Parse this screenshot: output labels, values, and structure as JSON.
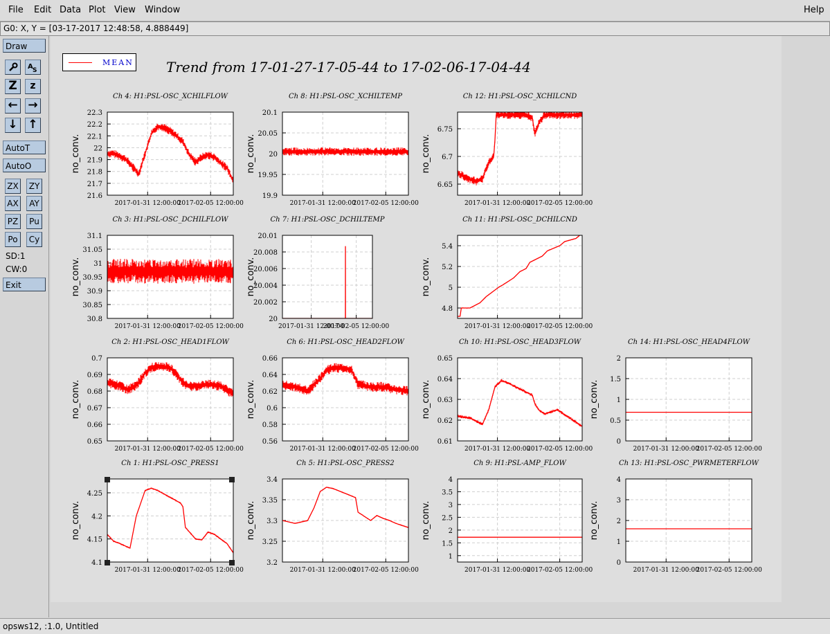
{
  "menu": {
    "file": "File",
    "edit": "Edit",
    "data": "Data",
    "plot": "Plot",
    "view": "View",
    "window": "Window",
    "help": "Help"
  },
  "coord_readout": "G0: X, Y = [03-17-2017 12:48:58, 4.888449]",
  "panel": {
    "draw": "Draw",
    "autot": "AutoT",
    "autoo": "AutoO",
    "zx": "ZX",
    "zy": "ZY",
    "ax": "AX",
    "ay": "AY",
    "pz": "PZ",
    "pu": "Pu",
    "po": "Po",
    "cy": "Cy",
    "sd": "SD:1",
    "cw": "CW:0",
    "exit": "Exit",
    "icons": {
      "draw_tool": "wrench-icon",
      "text_tool": "text-tool-icon",
      "zoom_z_big": "Z",
      "zoom_z_small": "z",
      "left": "←",
      "right": "→",
      "down": "↓",
      "up": "↑"
    }
  },
  "legend_label": "MEAN",
  "title": "Trend from 17-01-27-17-05-44 to 17-02-06-17-04-44",
  "status": "opsws12, :1.0, Untitled",
  "colors": {
    "series": "#ff0000",
    "legend_text": "#0000cc",
    "button": "#b8cbe0"
  },
  "chart_data": [
    {
      "type": "line",
      "title": "Ch 4: H1:PSL-OSC_XCHILFLOW",
      "ylabel": "no_conv.",
      "yticks": [
        "22.3",
        "22.2",
        "22.1",
        "22",
        "21.9",
        "21.8",
        "21.7",
        "21.6"
      ],
      "ylim": [
        21.6,
        22.3
      ],
      "xticks": [
        "2017-01-31 12:00:00",
        "2017-02-05 12:00:00"
      ],
      "x": [
        0,
        0.05,
        0.1,
        0.15,
        0.2,
        0.25,
        0.3,
        0.35,
        0.4,
        0.45,
        0.5,
        0.55,
        0.6,
        0.65,
        0.7,
        0.75,
        0.8,
        0.85,
        0.9,
        0.95,
        1
      ],
      "y": [
        21.95,
        21.95,
        21.93,
        21.9,
        21.84,
        21.78,
        21.95,
        22.12,
        22.18,
        22.17,
        22.14,
        22.1,
        22.05,
        21.94,
        21.88,
        21.92,
        21.94,
        21.92,
        21.87,
        21.83,
        21.72
      ],
      "band": 0.07
    },
    {
      "type": "line",
      "title": "Ch 8: H1:PSL-OSC_XCHILTEMP",
      "ylabel": "no_conv.",
      "yticks": [
        "20.1",
        "20.05",
        "20",
        "19.95",
        "19.9"
      ],
      "ylim": [
        19.9,
        20.1
      ],
      "xticks": [
        "2017-01-31 12:00:00",
        "2017-02-05 12:00:00"
      ],
      "x": [
        0,
        0.1,
        0.2,
        0.3,
        0.4,
        0.5,
        0.6,
        0.7,
        0.8,
        0.9,
        1
      ],
      "y": [
        20.005,
        20.005,
        20.005,
        20.005,
        20.005,
        20.005,
        20.005,
        20.005,
        20.005,
        20.005,
        20.005
      ],
      "band": 0.02
    },
    {
      "type": "line",
      "title": "Ch 12: H1:PSL-OSC_XCHILCND",
      "ylabel": "no_conv.",
      "yticks": [
        "6.75",
        "6.7",
        "6.65"
      ],
      "ylim": [
        6.63,
        6.78
      ],
      "xticks": [
        "2017-01-31 12:00:00",
        "2017-02-05 12:00:00"
      ],
      "x": [
        0,
        0.08,
        0.15,
        0.2,
        0.25,
        0.29,
        0.3,
        0.31,
        0.4,
        0.5,
        0.55,
        0.6,
        0.62,
        0.65,
        0.7,
        0.8,
        0.9,
        1
      ],
      "y": [
        6.67,
        6.66,
        6.655,
        6.66,
        6.69,
        6.7,
        6.73,
        6.775,
        6.775,
        6.775,
        6.775,
        6.77,
        6.74,
        6.76,
        6.775,
        6.775,
        6.775,
        6.775
      ],
      "band": 0.015
    },
    {
      "type": "line",
      "title": "Ch 3: H1:PSL-OSC_DCHILFLOW",
      "ylabel": "no_conv.",
      "yticks": [
        "31.1",
        "31.05",
        "31",
        "30.95",
        "30.9",
        "30.85",
        "30.8"
      ],
      "ylim": [
        30.8,
        31.1
      ],
      "xticks": [
        "2017-01-31 12:00:00",
        "2017-02-05 12:00:00"
      ],
      "x": [
        0,
        0.1,
        0.2,
        0.3,
        0.4,
        0.5,
        0.6,
        0.7,
        0.8,
        0.9,
        1
      ],
      "y": [
        30.97,
        30.97,
        30.97,
        30.97,
        30.97,
        30.97,
        30.97,
        30.97,
        30.97,
        30.97,
        30.97
      ],
      "band": 0.09
    },
    {
      "type": "line",
      "title": "Ch 7: H1:PSL-OSC_DCHILTEMP",
      "ylabel": "no_conv.",
      "yticks": [
        "20.01",
        "20.008",
        "20.006",
        "20.004",
        "20.002",
        "20"
      ],
      "ylim": [
        20,
        20.01
      ],
      "xticks": [
        "2017-01-31 12:00:00",
        "2017-02-05 12:00:00"
      ],
      "x": [
        0,
        0.699,
        0.7,
        0.701,
        1
      ],
      "y": [
        20,
        20,
        20.0087,
        20,
        20
      ],
      "band": 0
    },
    {
      "type": "line",
      "title": "Ch 11: H1:PSL-OSC_DCHILCND",
      "ylabel": "no_conv.",
      "yticks": [
        "5.4",
        "5.2",
        "5",
        "4.8"
      ],
      "ylim": [
        4.7,
        5.5
      ],
      "xticks": [
        "2017-01-31 12:00:00",
        "2017-02-05 12:00:00"
      ],
      "x": [
        0,
        0.02,
        0.03,
        0.1,
        0.18,
        0.23,
        0.33,
        0.36,
        0.45,
        0.5,
        0.55,
        0.58,
        0.68,
        0.72,
        0.82,
        0.86,
        0.95,
        1
      ],
      "y": [
        4.72,
        4.72,
        4.8,
        4.8,
        4.85,
        4.91,
        5.0,
        5.02,
        5.09,
        5.15,
        5.18,
        5.24,
        5.3,
        5.35,
        5.4,
        5.44,
        5.47,
        5.52
      ],
      "band": 0.01
    },
    {
      "type": "line",
      "title": "Ch 2: H1:PSL-OSC_HEAD1FLOW",
      "ylabel": "no_conv.",
      "yticks": [
        "0.7",
        "0.69",
        "0.68",
        "0.67",
        "0.66",
        "0.65"
      ],
      "ylim": [
        0.65,
        0.7
      ],
      "xticks": [
        "2017-01-31 12:00:00",
        "2017-02-05 12:00:00"
      ],
      "x": [
        0,
        0.1,
        0.15,
        0.2,
        0.25,
        0.3,
        0.35,
        0.4,
        0.5,
        0.55,
        0.6,
        0.65,
        0.7,
        0.8,
        0.9,
        1
      ],
      "y": [
        0.685,
        0.683,
        0.681,
        0.682,
        0.685,
        0.691,
        0.694,
        0.695,
        0.694,
        0.69,
        0.685,
        0.683,
        0.683,
        0.684,
        0.683,
        0.678
      ],
      "band": 0.006
    },
    {
      "type": "line",
      "title": "Ch 6: H1:PSL-OSC_HEAD2FLOW",
      "ylabel": "no_conv.",
      "yticks": [
        "0.66",
        "0.64",
        "0.62",
        "0.6",
        "0.58",
        "0.56"
      ],
      "ylim": [
        0.56,
        0.66
      ],
      "xticks": [
        "2017-01-31 12:00:00",
        "2017-02-05 12:00:00"
      ],
      "x": [
        0,
        0.1,
        0.2,
        0.3,
        0.35,
        0.4,
        0.5,
        0.55,
        0.6,
        0.7,
        0.8,
        0.9,
        1
      ],
      "y": [
        0.628,
        0.625,
        0.62,
        0.635,
        0.645,
        0.648,
        0.648,
        0.645,
        0.628,
        0.625,
        0.625,
        0.622,
        0.62
      ],
      "band": 0.012
    },
    {
      "type": "line",
      "title": "Ch 10: H1:PSL-OSC_HEAD3FLOW",
      "ylabel": "no_conv.",
      "yticks": [
        "0.65",
        "0.64",
        "0.63",
        "0.62",
        "0.61"
      ],
      "ylim": [
        0.61,
        0.65
      ],
      "xticks": [
        "2017-01-31 12:00:00",
        "2017-02-05 12:00:00"
      ],
      "x": [
        0,
        0.1,
        0.2,
        0.25,
        0.3,
        0.35,
        0.4,
        0.5,
        0.6,
        0.62,
        0.65,
        0.7,
        0.8,
        0.85,
        0.9,
        1
      ],
      "y": [
        0.622,
        0.621,
        0.618,
        0.625,
        0.636,
        0.639,
        0.638,
        0.635,
        0.632,
        0.628,
        0.625,
        0.623,
        0.625,
        0.623,
        0.621,
        0.617
      ],
      "band": 0.0015
    },
    {
      "type": "line",
      "title": "Ch 14: H1:PSL-OSC_HEAD4FLOW",
      "ylabel": "no_conv.",
      "yticks": [
        "2",
        "1.5",
        "1",
        "0.5",
        "0"
      ],
      "ylim": [
        0,
        2
      ],
      "xticks": [
        "2017-01-31 12:00:00",
        "2017-02-05 12:00:00"
      ],
      "x": [
        0,
        1
      ],
      "y": [
        0.69,
        0.69
      ],
      "band": 0
    },
    {
      "type": "line",
      "title": "Ch 1: H1:PSL-OSC_PRESS1",
      "ylabel": "no_conv.",
      "yticks": [
        "4.25",
        "4.2",
        "4.15",
        "4.1"
      ],
      "ylim": [
        4.1,
        4.28
      ],
      "xticks": [
        "2017-01-31 12:00:00",
        "2017-02-05 12:00:00"
      ],
      "x": [
        0,
        0.05,
        0.1,
        0.18,
        0.23,
        0.3,
        0.35,
        0.4,
        0.5,
        0.58,
        0.6,
        0.62,
        0.7,
        0.75,
        0.8,
        0.85,
        0.9,
        0.95,
        1
      ],
      "y": [
        4.16,
        4.145,
        4.14,
        4.13,
        4.2,
        4.255,
        4.26,
        4.255,
        4.24,
        4.228,
        4.22,
        4.175,
        4.15,
        4.148,
        4.165,
        4.16,
        4.15,
        4.14,
        4.12
      ],
      "band": 0.004
    },
    {
      "type": "line",
      "title": "Ch 5: H1:PSL-OSC_PRESS2",
      "ylabel": "no_conv.",
      "yticks": [
        "3.4",
        "3.35",
        "3.3",
        "3.25",
        "3.2"
      ],
      "ylim": [
        3.2,
        3.4
      ],
      "xticks": [
        "2017-01-31 12:00:00",
        "2017-02-05 12:00:00"
      ],
      "x": [
        0,
        0.1,
        0.2,
        0.25,
        0.3,
        0.35,
        0.4,
        0.5,
        0.58,
        0.6,
        0.65,
        0.7,
        0.75,
        0.8,
        0.85,
        0.9,
        1
      ],
      "y": [
        3.3,
        3.293,
        3.3,
        3.33,
        3.37,
        3.38,
        3.377,
        3.365,
        3.355,
        3.32,
        3.31,
        3.3,
        3.312,
        3.305,
        3.3,
        3.293,
        3.283
      ],
      "band": 0.003
    },
    {
      "type": "line",
      "title": "Ch 9: H1:PSL-AMP_FLOW",
      "ylabel": "no_conv.",
      "yticks": [
        "4",
        "3.5",
        "3",
        "2.5",
        "2",
        "1.5",
        "1"
      ],
      "ylim": [
        0.75,
        4
      ],
      "xticks": [
        "2017-01-31 12:00:00",
        "2017-02-05 12:00:00"
      ],
      "x": [
        0,
        1
      ],
      "y": [
        1.72,
        1.72
      ],
      "band": 0
    },
    {
      "type": "line",
      "title": "Ch 13: H1:PSL-OSC_PWRMETERFLOW",
      "ylabel": "no_conv.",
      "yticks": [
        "4",
        "3",
        "2",
        "1",
        "0"
      ],
      "ylim": [
        0,
        4
      ],
      "xticks": [
        "2017-01-31 12:00:00",
        "2017-02-05 12:00:00"
      ],
      "x": [
        0,
        1
      ],
      "y": [
        1.6,
        1.6
      ],
      "band": 0
    }
  ]
}
